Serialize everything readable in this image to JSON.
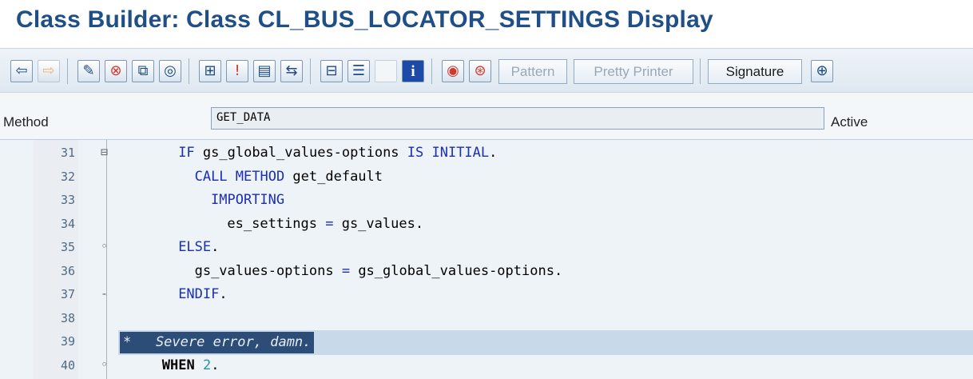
{
  "window": {
    "title": "Class Builder: Class CL_BUS_LOCATOR_SETTINGS Display"
  },
  "toolbar": {
    "icons": [
      "back-arrow-icon",
      "forward-arrow-icon",
      "edit-icon",
      "check-icon",
      "copy-icon",
      "spiral-icon",
      "hierarchy-icon",
      "info-bar-icon",
      "window-icon",
      "tree-icon",
      "layout-icon",
      "list-icon",
      "blank-icon",
      "info-icon",
      "stop-icon",
      "debug-icon",
      "overflow-icon"
    ],
    "pattern_label": "Pattern",
    "pretty_printer_label": "Pretty Printer",
    "signature_label": "Signature"
  },
  "method": {
    "label": "Method",
    "value": "GET_DATA",
    "status": "Active"
  },
  "editor": {
    "lines": [
      {
        "num": "31",
        "fold": "⊟",
        "indent": 6,
        "parts": [
          [
            "kw",
            "IF "
          ],
          [
            "",
            "gs_global_values-options "
          ],
          [
            "kw",
            "IS INITIAL"
          ],
          [
            "",
            "."
          ]
        ]
      },
      {
        "num": "32",
        "fold": "",
        "indent": 8,
        "parts": [
          [
            "kw",
            "CALL METHOD "
          ],
          [
            "",
            "get_default"
          ]
        ]
      },
      {
        "num": "33",
        "fold": "",
        "indent": 10,
        "parts": [
          [
            "kw",
            "IMPORTING"
          ]
        ]
      },
      {
        "num": "34",
        "fold": "",
        "indent": 12,
        "parts": [
          [
            "",
            "es_settings "
          ],
          [
            "kw",
            "= "
          ],
          [
            "",
            "gs_values."
          ]
        ]
      },
      {
        "num": "35",
        "fold": "◦",
        "indent": 6,
        "parts": [
          [
            "kw",
            "ELSE"
          ],
          [
            "",
            "."
          ]
        ]
      },
      {
        "num": "36",
        "fold": "",
        "indent": 8,
        "parts": [
          [
            "",
            "gs_values-options "
          ],
          [
            "kw",
            "= "
          ],
          [
            "",
            "gs_global_values-options."
          ]
        ]
      },
      {
        "num": "37",
        "fold": "-",
        "indent": 6,
        "parts": [
          [
            "kw",
            "ENDIF"
          ],
          [
            "",
            "."
          ]
        ]
      },
      {
        "num": "38",
        "fold": "",
        "indent": 0,
        "parts": []
      },
      {
        "num": "39",
        "fold": "",
        "comment": "*   Severe error, damn."
      },
      {
        "num": "40",
        "fold": "◦",
        "indent": 4,
        "parts": [
          [
            "kwb",
            "WHEN "
          ],
          [
            "num",
            "2"
          ],
          [
            "",
            "."
          ]
        ]
      }
    ]
  }
}
